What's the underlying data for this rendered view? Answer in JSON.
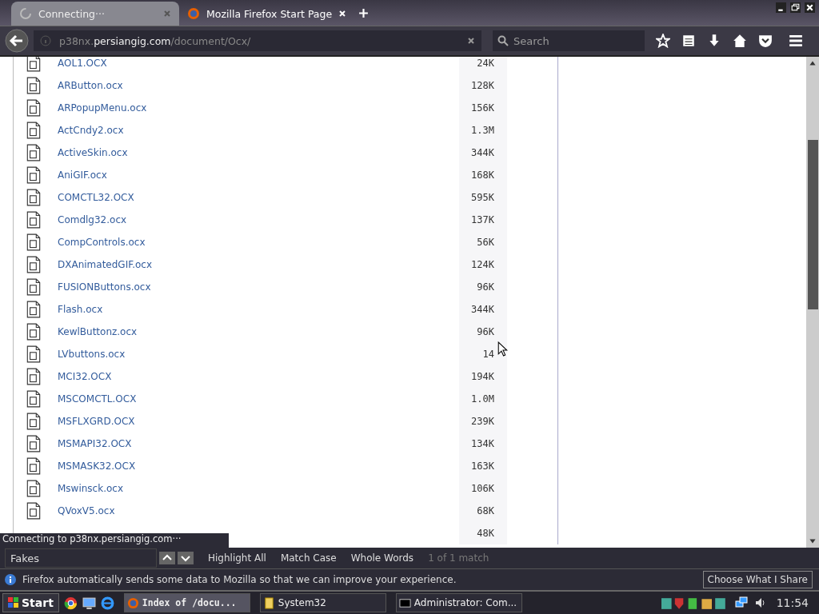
{
  "tabs": [
    {
      "label": "Connecting···",
      "selected": true,
      "loading": true
    },
    {
      "label": "Mozilla Firefox Start Page",
      "selected": false,
      "loading": false
    }
  ],
  "address": {
    "prefix": "p38nx.",
    "domain": "persiangig.com",
    "path": "/document/Ocx/"
  },
  "search": {
    "placeholder": "Search"
  },
  "files": [
    {
      "name": "AOL1.OCX",
      "size": "24K"
    },
    {
      "name": "ARButton.ocx",
      "size": "128K"
    },
    {
      "name": "ARPopupMenu.ocx",
      "size": "156K"
    },
    {
      "name": "ActCndy2.ocx",
      "size": "1.3M"
    },
    {
      "name": "ActiveSkin.ocx",
      "size": "344K"
    },
    {
      "name": "AniGIF.ocx",
      "size": "168K"
    },
    {
      "name": "COMCTL32.OCX",
      "size": "595K"
    },
    {
      "name": "Comdlg32.ocx",
      "size": "137K"
    },
    {
      "name": "CompControls.ocx",
      "size": "56K"
    },
    {
      "name": "DXAnimatedGIF.ocx",
      "size": "124K"
    },
    {
      "name": "FUSIONButtons.ocx",
      "size": "96K"
    },
    {
      "name": "Flash.ocx",
      "size": "344K"
    },
    {
      "name": "KewlButtonz.ocx",
      "size": "96K"
    },
    {
      "name": "LVbuttons.ocx",
      "size": "14"
    },
    {
      "name": "MCI32.OCX",
      "size": "194K"
    },
    {
      "name": "MSCOMCTL.OCX",
      "size": "1.0M"
    },
    {
      "name": "MSFLXGRD.OCX",
      "size": "239K"
    },
    {
      "name": "MSMAPI32.OCX",
      "size": "134K"
    },
    {
      "name": "MSMASK32.OCX",
      "size": "163K"
    },
    {
      "name": "Mswinsck.ocx",
      "size": "106K"
    },
    {
      "name": "QVoxV5.ocx",
      "size": "68K"
    },
    {
      "size": "48K"
    }
  ],
  "status": "Connecting to p38nx.persiangig.com···",
  "findbar": {
    "value": "Fakes",
    "options": [
      "Highlight All",
      "Match Case",
      "Whole Words"
    ],
    "result": "1 of 1 match"
  },
  "notification": {
    "message": "Firefox automatically sends some data to Mozilla so that we can improve your experience.",
    "button": "Choose What I Share"
  },
  "taskbar": {
    "start": "Start",
    "tasks": [
      {
        "label": "Index of /docu...",
        "selected": true,
        "kind": "firefox"
      },
      {
        "label": "System32",
        "selected": false,
        "kind": "folder"
      },
      {
        "label": "Administrator: Com...",
        "selected": false,
        "kind": "console"
      }
    ],
    "clock": "11:54"
  }
}
